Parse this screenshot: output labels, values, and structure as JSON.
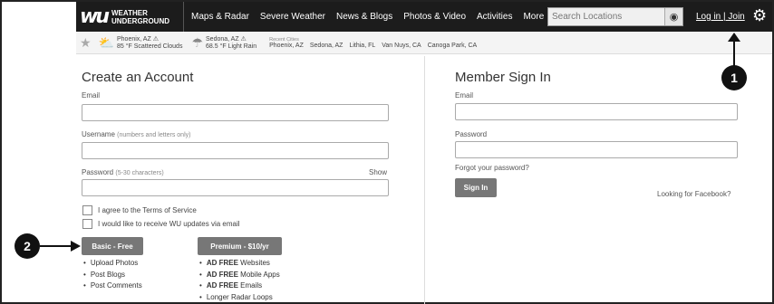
{
  "header": {
    "logo_line1": "WEATHER",
    "logo_line2": "UNDERGROUND",
    "nav": [
      "Maps & Radar",
      "Severe Weather",
      "News & Blogs",
      "Photos & Video",
      "Activities"
    ],
    "more_label": "More",
    "search_placeholder": "Search Locations",
    "login_label": "Log in | Join"
  },
  "cities_bar": {
    "favorites": [
      {
        "name": "Phoenix, AZ ⚠",
        "condition": "85 °F Scattered Clouds",
        "icon": "partly-cloudy-icon"
      },
      {
        "name": "Sedona, AZ ⚠",
        "condition": "68.5 °F Light Rain",
        "icon": "rain-icon"
      }
    ],
    "recent_label": "Recent Cities",
    "recent": [
      "Phoenix, AZ",
      "Sedona, AZ",
      "Lithia, FL",
      "Van Nuys, CA",
      "Canoga Park, CA"
    ]
  },
  "create_account": {
    "title": "Create an Account",
    "email_label": "Email",
    "username_label": "Username",
    "username_hint": "(numbers and letters only)",
    "password_label": "Password",
    "password_hint": "(5-30 characters)",
    "show_label": "Show",
    "terms_label": "I agree to the Terms of Service",
    "updates_label": "I would like to receive WU updates via email",
    "basic_button": "Basic - Free",
    "premium_button": "Premium - $10/yr",
    "basic_features": [
      "Upload Photos",
      "Post Blogs",
      "Post Comments"
    ],
    "premium_features": [
      {
        "bold": "AD FREE",
        "text": " Websites"
      },
      {
        "bold": "AD FREE",
        "text": " Mobile Apps"
      },
      {
        "bold": "AD FREE",
        "text": " Emails"
      },
      {
        "bold": "",
        "text": "Longer Radar Loops"
      }
    ]
  },
  "sign_in": {
    "title": "Member Sign In",
    "email_label": "Email",
    "password_label": "Password",
    "forgot_label": "Forgot your password?",
    "button": "Sign In",
    "facebook_label": "Looking for Facebook?"
  },
  "callouts": {
    "one": "1",
    "two": "2"
  }
}
